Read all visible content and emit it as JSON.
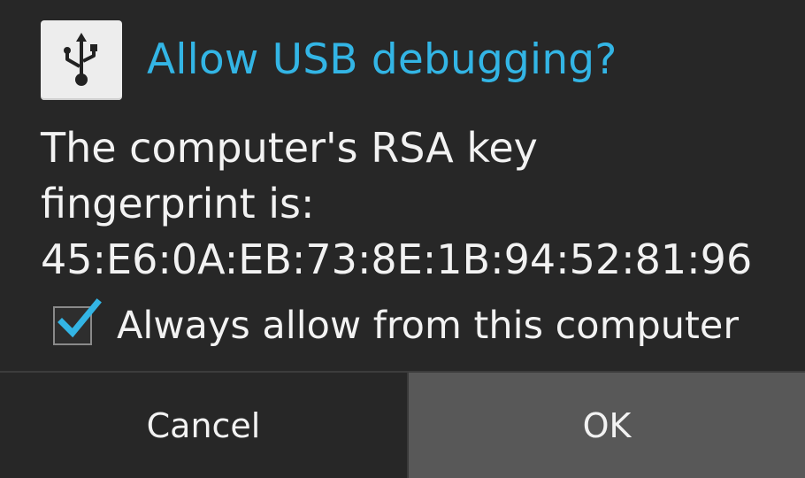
{
  "dialog": {
    "title": "Allow USB debugging?",
    "icon": "usb-icon",
    "message_lines": [
      "The computer's RSA key",
      "fingerprint is:",
      "45:E6:0A:EB:73:8E:1B:94:52:81:96"
    ],
    "checkbox": {
      "label": "Always allow from this computer",
      "checked": true
    },
    "buttons": {
      "cancel": "Cancel",
      "ok": "OK"
    }
  },
  "colors": {
    "title": "#33b5e5",
    "checkmark": "#33b5e5",
    "background": "#272727",
    "ok_button_bg": "#585858"
  }
}
